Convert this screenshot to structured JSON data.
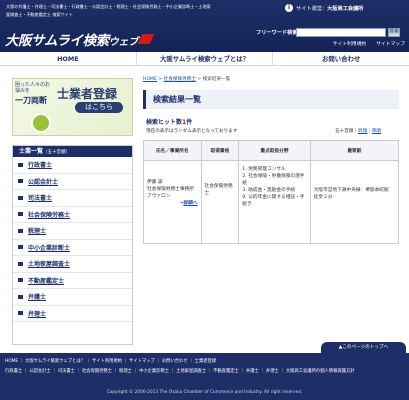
{
  "header": {
    "tagline": "大阪の弁護士・弁理士・司法書士・行政書士・公認会計士・税理士・社会保険労務士・中小企業診断士・土地家屋調査士・不動産鑑定士 検索サイト",
    "logo_text": "大阪サムライ検索",
    "logo_suffix": "ウェブ",
    "site_management_label": "サイト運営：",
    "site_management_name": "大阪商工会議所",
    "free_word_search_label": "フリーワード検索",
    "search_value": "",
    "search_button_label": "検索",
    "links": [
      "サイト利用規約",
      "サイトマップ"
    ]
  },
  "global_nav": [
    "HOME",
    "大阪サムライ検索ウェブとは？",
    "お問い合わせ"
  ],
  "banner": {
    "lead": "困った人々のお悩みを",
    "lead_big": "一刀両断",
    "title": "士業者登録",
    "cta": "はこちら"
  },
  "sidebar": {
    "heading": "士業一覧",
    "heading_sub": "（五十音順）",
    "items": [
      "行政書士",
      "公認会計士",
      "司法書士",
      "社会保険労務士",
      "税理士",
      "中小企業診断士",
      "土地家屋調査士",
      "不動産鑑定士",
      "弁護士",
      "弁理士"
    ]
  },
  "breadcrumb": {
    "home": "HOME",
    "sep": " > ",
    "category": "社会保険労務士",
    "current": "検索結果一覧"
  },
  "page_title": "検索結果一覧",
  "results": {
    "hit_label": "検索ヒット数",
    "hit_count": "1",
    "hit_unit": "件",
    "note": "現在の表示はランダム表示となっております",
    "sort_label": "五十音順",
    "sort_options": [
      "昇順",
      "降順"
    ],
    "columns": [
      "氏名／事業所名",
      "取得資格",
      "重点取扱分野",
      "最寄駅"
    ],
    "rows": [
      {
        "name": "伊藤 諭",
        "office": "社会保険労務士事務所アヴァロン",
        "detail_link": "詳細へ",
        "qualification": "社会保険労務士",
        "specialties": "1. 労務管理コンサル\n2. 社会保険・労働保険の諸手続\n3. 助成金・奨励金の手続\n9. 公的年金に関する相談・手続き",
        "station": "大阪市営地下鉄中央線　堺筋本町駅　徒歩２分"
      }
    ]
  },
  "page_top_label": "▲このページのトップへ",
  "footer": {
    "links_row1": "HOME ｜ 大阪サムライ検索ウェブとは？ ｜ サイト利用規約 ｜ サイトマップ ｜ お問い合わせ ｜ 士業者登録",
    "links_row2": "行政書士 ｜ 公認会計士 ｜ 司法書士 ｜ 社会保険労務士 ｜ 税理士 ｜ 中小企業診断士 ｜ 土地家屋調査士 ｜ 不動産鑑定士 ｜ 弁護士 ｜ 弁理士 ｜ 大阪商工会議所の個人情報保護方針",
    "copyright": "Copyright © 2006-2013 The Osaka Chamber of Commerce and Industry. All right reserved."
  }
}
